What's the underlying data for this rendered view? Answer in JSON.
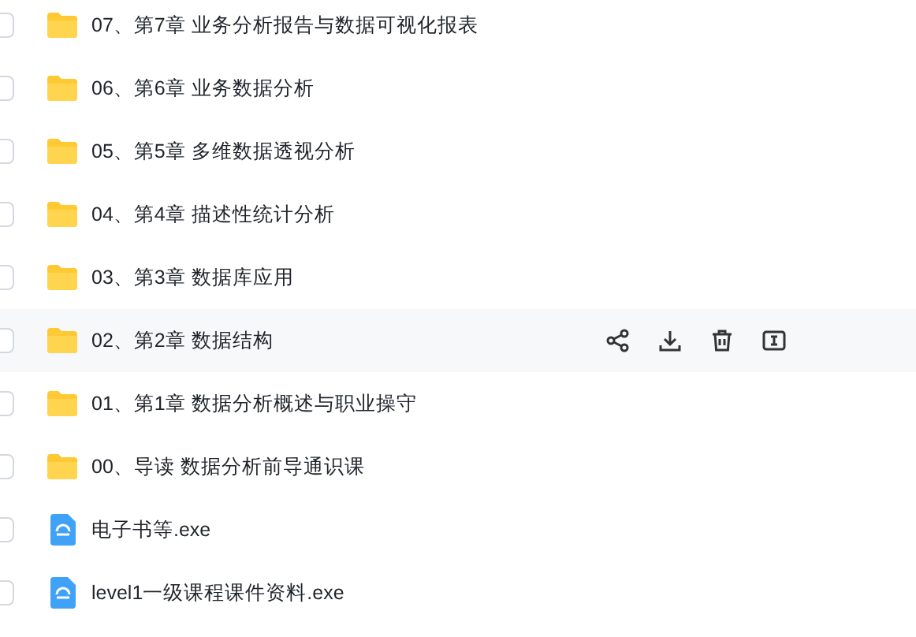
{
  "files": [
    {
      "name": "07、第7章 业务分析报告与数据可视化报表",
      "kind": "folder",
      "hovered": false
    },
    {
      "name": "06、第6章 业务数据分析",
      "kind": "folder",
      "hovered": false
    },
    {
      "name": "05、第5章 多维数据透视分析",
      "kind": "folder",
      "hovered": false
    },
    {
      "name": "04、第4章 描述性统计分析",
      "kind": "folder",
      "hovered": false
    },
    {
      "name": "03、第3章 数据库应用",
      "kind": "folder",
      "hovered": false
    },
    {
      "name": "02、第2章 数据结构",
      "kind": "folder",
      "hovered": true
    },
    {
      "name": "01、第1章 数据分析概述与职业操守",
      "kind": "folder",
      "hovered": false
    },
    {
      "name": "00、导读 数据分析前导通识课",
      "kind": "folder",
      "hovered": false
    },
    {
      "name": "电子书等.exe",
      "kind": "exe",
      "hovered": false
    },
    {
      "name": "level1一级课程课件资料.exe",
      "kind": "exe",
      "hovered": false
    }
  ]
}
